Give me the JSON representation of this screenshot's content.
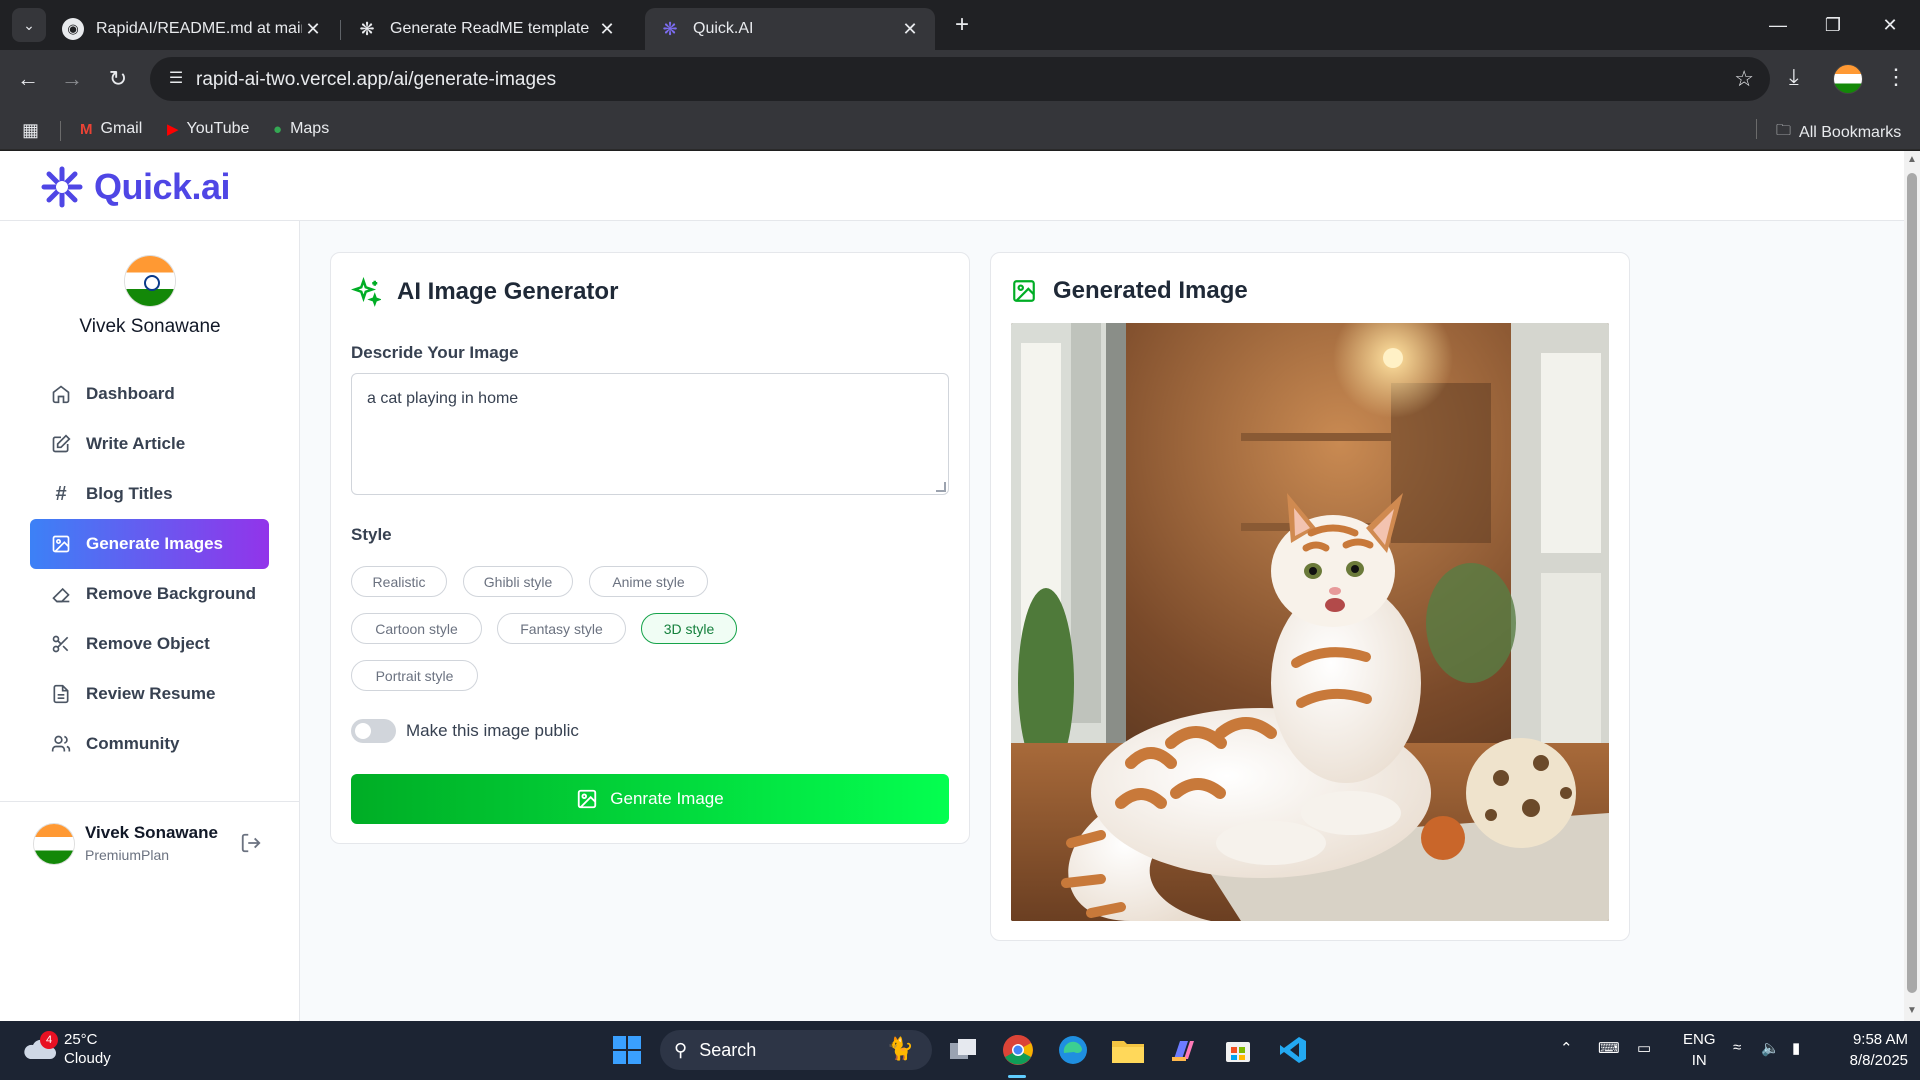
{
  "browser": {
    "tabs": [
      {
        "title": "RapidAI/README.md at main · ",
        "icon": "github-icon",
        "active": false
      },
      {
        "title": "Generate ReadME template",
        "icon": "chatgpt-icon",
        "active": false
      },
      {
        "title": "Quick.AI",
        "icon": "quickai-icon",
        "active": true
      }
    ],
    "url": "rapid-ai-two.vercel.app/ai/generate-images",
    "bookmarks": [
      {
        "label": "Gmail",
        "icon": "gmail-icon"
      },
      {
        "label": "YouTube",
        "icon": "youtube-icon"
      },
      {
        "label": "Maps",
        "icon": "maps-icon"
      }
    ],
    "all_bookmarks": "All Bookmarks"
  },
  "app": {
    "logo_text": "Quick.ai",
    "brand_color": "#4f46e5"
  },
  "sidebar": {
    "user_name": "Vivek Sonawane",
    "items": [
      {
        "label": "Dashboard",
        "icon": "home-icon"
      },
      {
        "label": "Write Article",
        "icon": "edit-icon"
      },
      {
        "label": "Blog Titles",
        "icon": "hash-icon"
      },
      {
        "label": "Generate Images",
        "icon": "image-icon",
        "active": true
      },
      {
        "label": "Remove Background",
        "icon": "eraser-icon"
      },
      {
        "label": "Remove Object",
        "icon": "scissors-icon"
      },
      {
        "label": "Review Resume",
        "icon": "file-text-icon"
      },
      {
        "label": "Community",
        "icon": "users-icon"
      }
    ],
    "footer": {
      "name": "Vivek Sonawane",
      "plan": "PremiumPlan"
    }
  },
  "generator": {
    "title": "AI Image Generator",
    "describe_label": "Descride Your Image",
    "prompt_value": "a cat playing in home",
    "style_label": "Style",
    "styles": [
      "Realistic",
      "Ghibli style",
      "Anime style",
      "Cartoon style",
      "Fantasy style",
      "3D style",
      "Portrait style"
    ],
    "selected_style": "3D style",
    "public_toggle_label": "Make this image public",
    "public_toggle_on": false,
    "button_label": "Genrate Image"
  },
  "result": {
    "title": "Generated Image"
  },
  "taskbar": {
    "weather_temp": "25°C",
    "weather_cond": "Cloudy",
    "weather_badge": "4",
    "search_label": "Search",
    "lang_top": "ENG",
    "lang_bottom": "IN",
    "time": "9:58 AM",
    "date": "8/8/2025"
  }
}
